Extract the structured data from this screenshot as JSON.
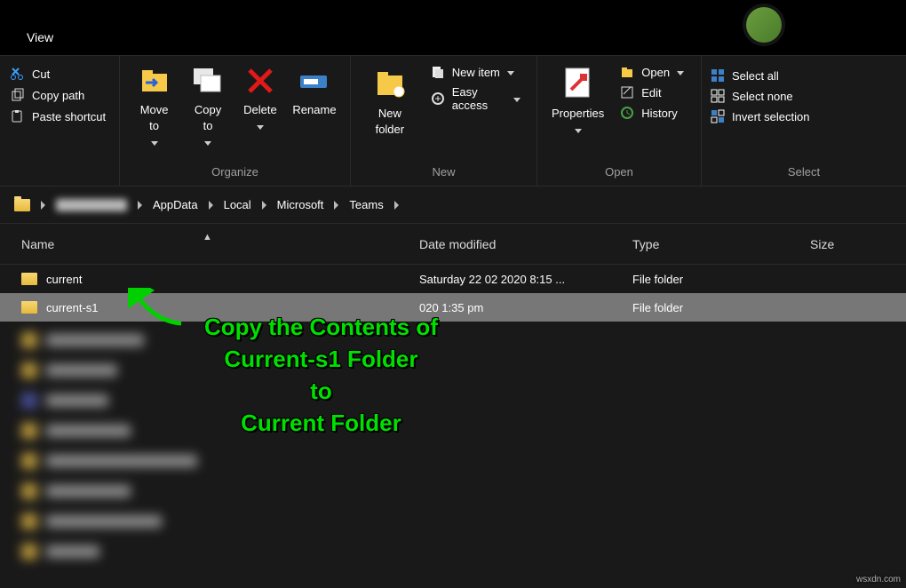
{
  "title_tab": "View",
  "ribbon": {
    "clipboard": {
      "cut": "Cut",
      "copy_path": "Copy path",
      "paste_shortcut": "Paste shortcut"
    },
    "organize": {
      "move_to": "Move to",
      "copy_to": "Copy to",
      "delete": "Delete",
      "rename": "Rename",
      "group_label": "Organize"
    },
    "new": {
      "new_folder": "New folder",
      "new_item": "New item",
      "easy_access": "Easy access",
      "group_label": "New"
    },
    "open": {
      "properties": "Properties",
      "open": "Open",
      "edit": "Edit",
      "history": "History",
      "group_label": "Open"
    },
    "select": {
      "select_all": "Select all",
      "select_none": "Select none",
      "invert": "Invert selection",
      "group_label": "Select"
    }
  },
  "breadcrumbs": [
    "",
    "AppData",
    "Local",
    "Microsoft",
    "Teams"
  ],
  "columns": {
    "name": "Name",
    "date": "Date modified",
    "type": "Type",
    "size": "Size"
  },
  "rows": [
    {
      "name": "current",
      "date": "Saturday 22 02 2020 8:15 ...",
      "type": "File folder",
      "selected": false
    },
    {
      "name": "current-s1",
      "date": "020 1:35 pm",
      "type": "File folder",
      "selected": true
    }
  ],
  "annotation_lines": [
    "Copy the Contents of",
    "Current-s1 Folder",
    "to",
    "Current Folder"
  ],
  "watermark": "wsxdn.com"
}
